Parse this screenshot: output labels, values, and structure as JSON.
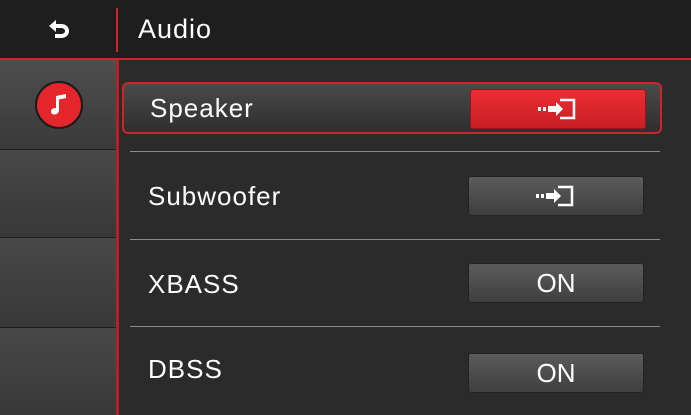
{
  "header": {
    "title": "Audio",
    "back_icon": "back-arrow-icon"
  },
  "sidebar": {
    "active_icon": "music-note-icon",
    "accent_color": "#e3262c",
    "item_count": 4
  },
  "settings": [
    {
      "label": "Speaker",
      "value": "",
      "value_icon": "input-arrow-icon",
      "selected": true
    },
    {
      "label": "Subwoofer",
      "value": "",
      "value_icon": "input-arrow-icon",
      "selected": false
    },
    {
      "label": "XBASS",
      "value": "ON",
      "selected": false
    },
    {
      "label": "DBSS",
      "value": "ON",
      "selected": false
    }
  ],
  "colors": {
    "accent": "#c9252b",
    "background": "#2b2b2b",
    "header_bg": "#1e1e1e"
  }
}
